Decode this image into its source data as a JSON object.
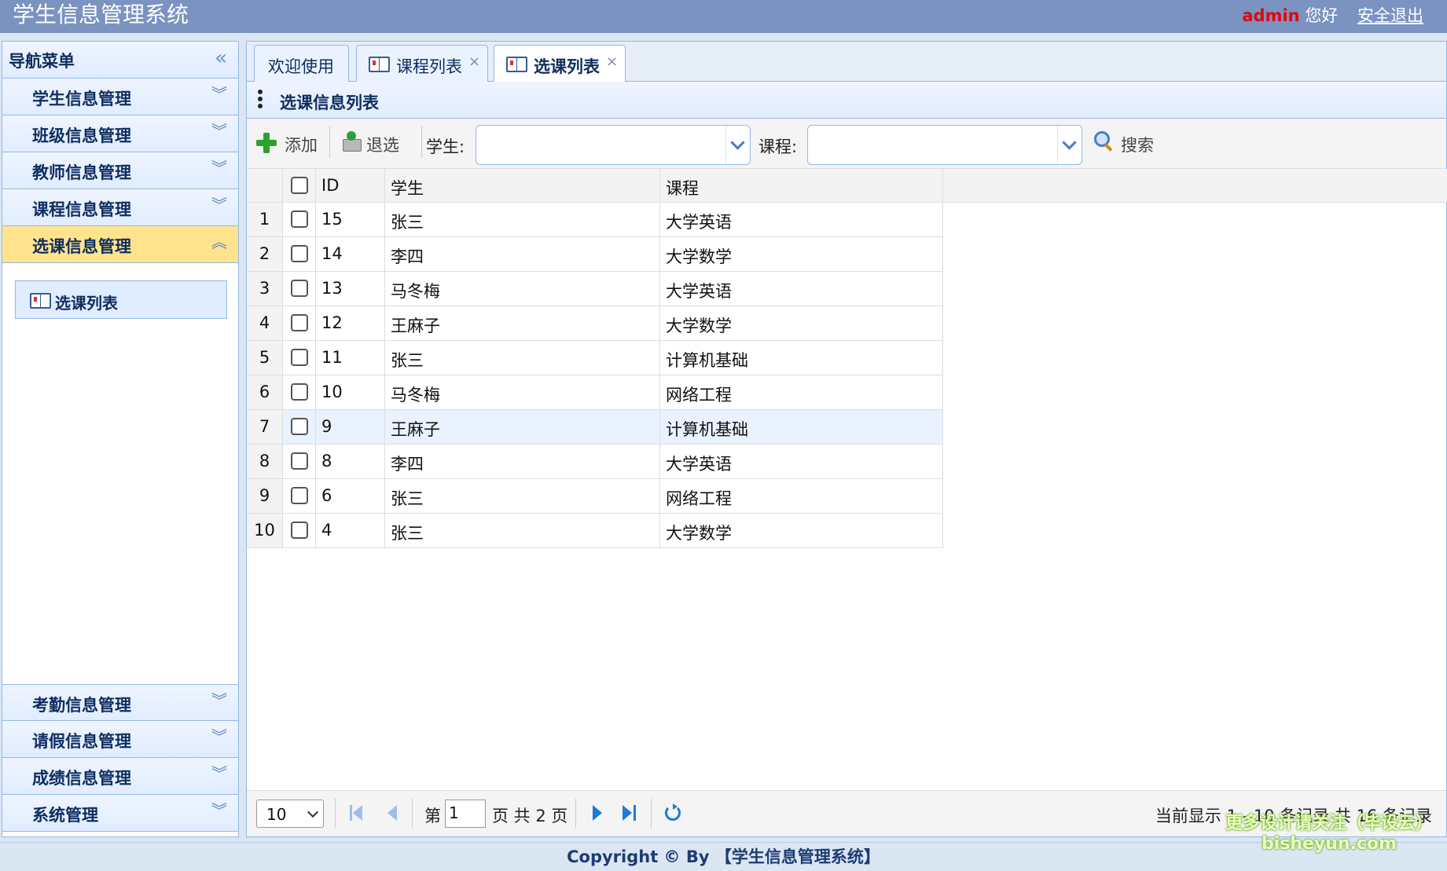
{
  "header": {
    "app_title": "学生信息管理系统",
    "user_name": "admin",
    "greeting": "您好",
    "logout_label": "安全退出"
  },
  "sidebar": {
    "title": "导航菜单",
    "menu_top": [
      {
        "label": "学生信息管理",
        "expanded": false
      },
      {
        "label": "班级信息管理",
        "expanded": false
      },
      {
        "label": "教师信息管理",
        "expanded": false
      },
      {
        "label": "课程信息管理",
        "expanded": false
      },
      {
        "label": "选课信息管理",
        "expanded": true
      }
    ],
    "submenu_item": "选课列表",
    "menu_bottom": [
      {
        "label": "考勤信息管理",
        "expanded": false
      },
      {
        "label": "请假信息管理",
        "expanded": false
      },
      {
        "label": "成绩信息管理",
        "expanded": false
      },
      {
        "label": "系统管理",
        "expanded": false
      }
    ]
  },
  "tabs": [
    {
      "label": "欢迎使用",
      "closable": false,
      "active": false
    },
    {
      "label": "课程列表",
      "closable": true,
      "active": false
    },
    {
      "label": "选课列表",
      "closable": true,
      "active": true
    }
  ],
  "tab_close_glyph": "×",
  "panel": {
    "title": "选课信息列表"
  },
  "toolbar": {
    "add_label": "添加",
    "withdraw_label": "退选",
    "student_label": "学生:",
    "course_label": "课程:",
    "student_value": "",
    "course_value": "",
    "search_label": "搜索"
  },
  "table": {
    "columns": [
      "ID",
      "学生",
      "课程"
    ],
    "rows": [
      {
        "num": "1",
        "id": "15",
        "student": "张三",
        "course": "大学英语"
      },
      {
        "num": "2",
        "id": "14",
        "student": "李四",
        "course": "大学数学"
      },
      {
        "num": "3",
        "id": "13",
        "student": "马冬梅",
        "course": "大学英语"
      },
      {
        "num": "4",
        "id": "12",
        "student": "王麻子",
        "course": "大学数学"
      },
      {
        "num": "5",
        "id": "11",
        "student": "张三",
        "course": "计算机基础"
      },
      {
        "num": "6",
        "id": "10",
        "student": "马冬梅",
        "course": "网络工程"
      },
      {
        "num": "7",
        "id": "9",
        "student": "王麻子",
        "course": "计算机基础"
      },
      {
        "num": "8",
        "id": "8",
        "student": "李四",
        "course": "大学英语"
      },
      {
        "num": "9",
        "id": "6",
        "student": "张三",
        "course": "网络工程"
      },
      {
        "num": "10",
        "id": "4",
        "student": "张三",
        "course": "大学数学"
      }
    ],
    "highlighted_row": 7
  },
  "pager": {
    "page_size": "10",
    "page_prefix": "第",
    "current_page": "1",
    "page_suffix": "页 共 2 页",
    "status": "当前显示 1 - 10 条记录 共 16 条记录"
  },
  "footer": {
    "text": "Copyright © By 【学生信息管理系统】"
  },
  "watermark": {
    "line1": "更多设计请关注（毕设云）",
    "line2": "bisheyun.com"
  },
  "colors": {
    "header_bg": "#7a93c0",
    "accent": "#95b8e7",
    "active_menu": "#ffe48d",
    "admin": "#e8000b"
  }
}
